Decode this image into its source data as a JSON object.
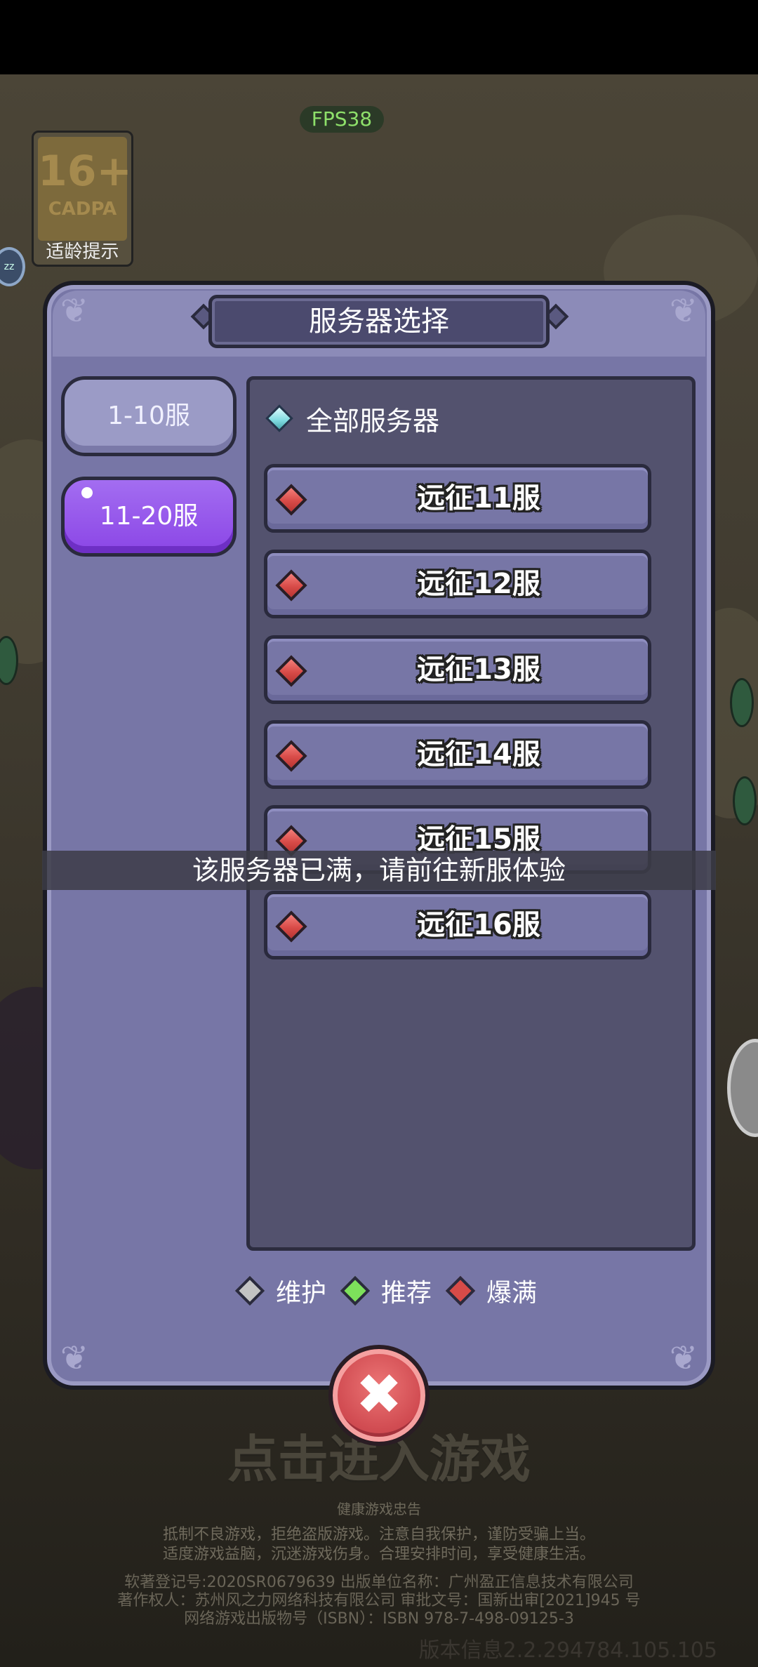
{
  "fps": "FPS38",
  "age_rating": {
    "number": "16+",
    "org": "CADPA",
    "caption": "适龄提示"
  },
  "dialog": {
    "title": "服务器选择",
    "tabs": [
      {
        "label": "1-10服",
        "active": false
      },
      {
        "label": "11-20服",
        "active": true
      }
    ],
    "all_servers_label": "全部服务器",
    "servers": [
      {
        "name": "远征11服",
        "status": "full"
      },
      {
        "name": "远征12服",
        "status": "full"
      },
      {
        "name": "远征13服",
        "status": "full"
      },
      {
        "name": "远征14服",
        "status": "full"
      },
      {
        "name": "远征15服",
        "status": "full"
      },
      {
        "name": "远征16服",
        "status": "full"
      }
    ],
    "legend": {
      "maintenance": "维护",
      "recommended": "推荐",
      "full": "爆满"
    },
    "colors": {
      "maintenance": "#c3c3c3",
      "recommended": "#7de05b",
      "full": "#d84b48",
      "tab_active": "#8b46e6"
    }
  },
  "toast": "该服务器已满，请前往新服体验",
  "enter_game": "点击进入游戏",
  "health_advice": {
    "title": "健康游戏忠告",
    "line1": "抵制不良游戏，拒绝盗版游戏。注意自我保护，谨防受骗上当。",
    "line2": "适度游戏益脑，沉迷游戏伤身。合理安排时间，享受健康生活。"
  },
  "copyright": {
    "line1": "软著登记号:2020SR0679639 出版单位名称：广州盈正信息技术有限公司",
    "line2": "著作权人：苏州风之力网络科技有限公司 审批文号：国新出审[2021]945 号",
    "line3": "网络游戏出版物号（ISBN）：ISBN 978-7-498-09125-3"
  },
  "version": "版本信息2.2.294784.105.105"
}
